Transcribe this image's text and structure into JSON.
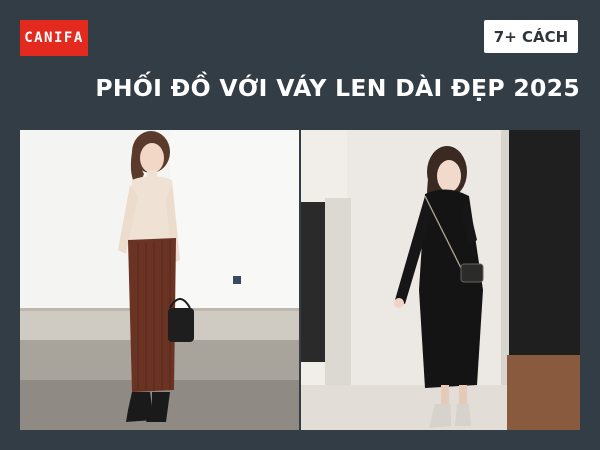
{
  "brand": {
    "logo_text": "CANIFA",
    "color": "#e42a1f"
  },
  "badge": {
    "text": "7+  CÁCH"
  },
  "headline": {
    "text": "PHỐI ĐỒ VỚI VÁY LEN DÀI ĐẸP 2025"
  },
  "photos": [
    {
      "name": "left-photo",
      "subject": "woman in cream turtleneck sweater and brown knit midi skirt with black handbag"
    },
    {
      "name": "right-photo",
      "subject": "woman in black knit turtleneck long dress with crossbody bag"
    }
  ],
  "colors": {
    "background": "#333d45",
    "text": "#ffffff",
    "badge_bg": "#ffffff"
  }
}
